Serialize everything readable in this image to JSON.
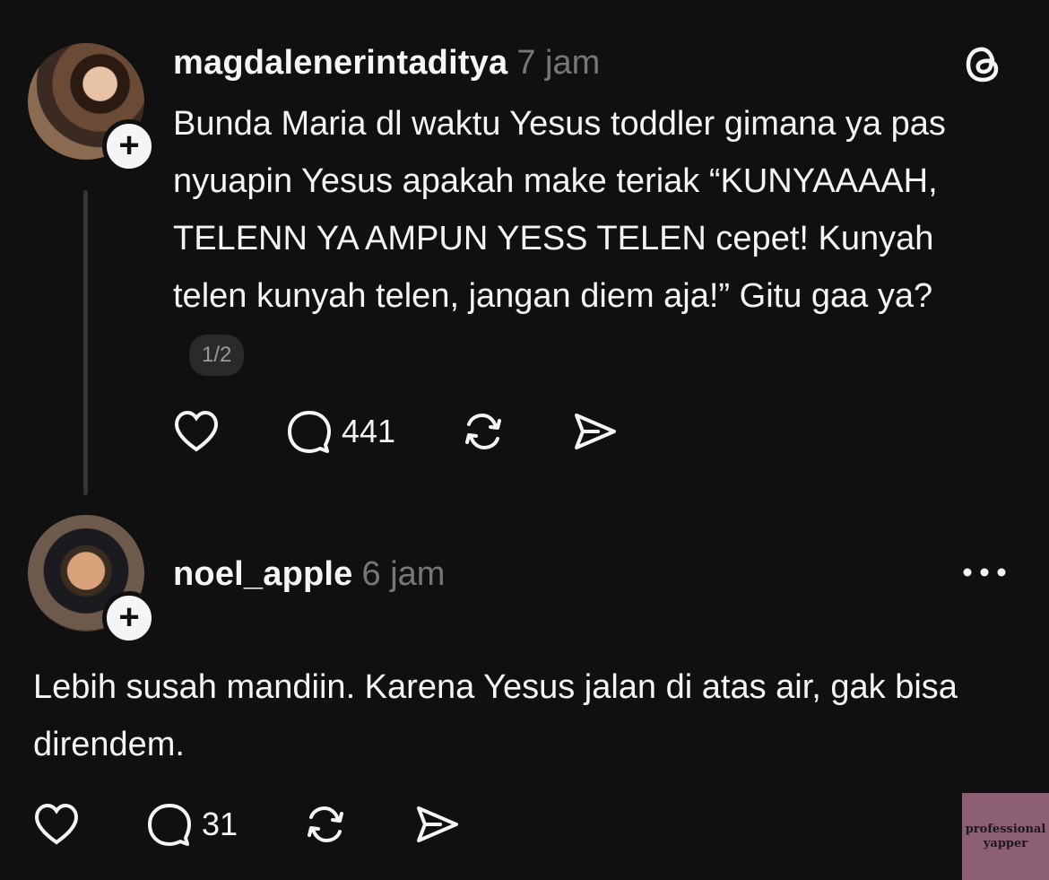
{
  "posts": [
    {
      "username": "magdalenerintaditya",
      "time": "7 jam",
      "text": "Bunda Maria dl waktu Yesus toddler gimana ya pas nyuapin Yesus apakah make teriak “KUNYAAAAH, TELENN YA AMPUN YESS TELEN cepet! Kunyah telen kunyah telen, jangan diem aja!” Gitu gaa ya?",
      "page_indicator": "1/2",
      "comments": "441",
      "corner_icon": "threads-logo-icon"
    },
    {
      "username": "noel_apple",
      "time": "6 jam",
      "text": "Lebih susah mandiin. Karena Yesus jalan di atas air, gak bisa direndem.",
      "comments": "31",
      "corner_icon": "more-dots-icon"
    }
  ],
  "follow_badge_glyph": "+",
  "watermark": {
    "line1": "professional",
    "line2": "yapper"
  },
  "colors": {
    "background": "#101010",
    "text": "#f3f5f7",
    "muted": "#777777",
    "watermark": "#8c5f74"
  }
}
